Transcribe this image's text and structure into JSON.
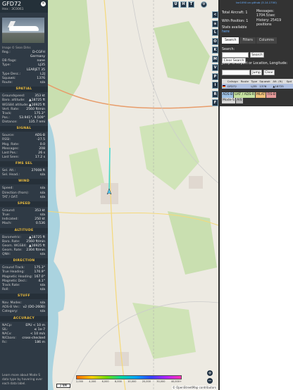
{
  "left": {
    "callsign": "GFD72",
    "hex_label": "Hex : 3C0061",
    "photo_credit": "Image © Sean Dirks",
    "info": [
      {
        "k": "Reg.:",
        "v": "D-CGFH"
      },
      {
        "k": "",
        "v": "Germany"
      },
      {
        "k": "DB flags:",
        "v": "none"
      },
      {
        "k": "Type:",
        "v": "LJ35"
      },
      {
        "k": "",
        "v": "LEARJET 35"
      },
      {
        "k": "Type Desc.:",
        "v": "L2J"
      },
      {
        "k": "Squawk:",
        "v": "1376"
      },
      {
        "k": "Route:",
        "v": "n/a"
      }
    ],
    "sections": [
      {
        "title": "SPATIAL",
        "rows": [
          {
            "k": "Groundspeed:",
            "v": "353 kt"
          },
          {
            "k": "Baro. altitude:",
            "v": "▲18725 ft"
          },
          {
            "k": "WGS84 altitude:",
            "v": "▲16925 ft"
          },
          {
            "k": "Vert. Rate:",
            "v": "2560 ft/min"
          },
          {
            "k": "Track:",
            "v": "175.3°"
          },
          {
            "k": "Pos.:",
            "v": "53.941°, 9.509°"
          },
          {
            "k": "Distance:",
            "v": "135.7 nmi"
          }
        ]
      },
      {
        "title": "SIGNAL",
        "rows": [
          {
            "k": "Source:",
            "v": "ADS-B"
          },
          {
            "k": "RSSI:",
            "v": "-27.5"
          },
          {
            "k": "Msg. Rate:",
            "v": "0.0"
          },
          {
            "k": "Messages:",
            "v": "208"
          },
          {
            "k": "Last Pos.:",
            "v": "26 s"
          },
          {
            "k": "Last Seen:",
            "v": "17.2 s"
          }
        ]
      },
      {
        "title": "FMS SEL",
        "rows": [
          {
            "k": "Sel. Alt.:",
            "v": "27008 ft"
          },
          {
            "k": "Sel. Head.:",
            "v": "n/a"
          }
        ]
      },
      {
        "title": "WIND",
        "rows": [
          {
            "k": "Speed:",
            "v": "n/a"
          },
          {
            "k": "Direction (from):",
            "v": "n/a"
          },
          {
            "k": "TAT / OAT:",
            "v": "n/a"
          }
        ]
      },
      {
        "title": "SPEED",
        "rows": [
          {
            "k": "Ground:",
            "v": "353 kt"
          },
          {
            "k": "True:",
            "v": "n/a"
          },
          {
            "k": "Indicated:",
            "v": "250 kt"
          },
          {
            "k": "Mach:",
            "v": "0.536"
          }
        ]
      },
      {
        "title": "ALTITUDE",
        "rows": [
          {
            "k": "Barometric:",
            "v": "▲18725 ft"
          },
          {
            "k": "Baro. Rate:",
            "v": "2560 ft/min"
          },
          {
            "k": "Geom. WGS84:",
            "v": "▲16925 ft"
          },
          {
            "k": "Geom. Rate:",
            "v": "2304 ft/min"
          },
          {
            "k": "QNH:",
            "v": "n/a"
          }
        ]
      },
      {
        "title": "DIRECTION",
        "rows": [
          {
            "k": "Ground Track:",
            "v": "175.3°"
          },
          {
            "k": "True Heading:",
            "v": "170.9°"
          },
          {
            "k": "Magnetic Heading:",
            "v": "167.0°"
          },
          {
            "k": "Magnetic Decl.:",
            "v": "4.1°"
          },
          {
            "k": "Track Rate:",
            "v": "n/a"
          },
          {
            "k": "Roll:",
            "v": "n/a"
          }
        ]
      },
      {
        "title": "STUFF",
        "rows": [
          {
            "k": "Nav. Modes:",
            "v": "n/a"
          },
          {
            "k": "ADS-B Ver.:",
            "v": "v2 (DO-260B)"
          },
          {
            "k": "Category:",
            "v": "n/a"
          }
        ]
      },
      {
        "title": "ACCURACY",
        "rows": [
          {
            "k": "NACp:",
            "v": "EPU < 10 m"
          },
          {
            "k": "SIL:",
            "v": "≤ 1e-7"
          },
          {
            "k": "NACv:",
            "v": "< 10 m/s"
          },
          {
            "k": "NICbaro:",
            "v": "cross-checked"
          },
          {
            "k": "Rc:",
            "v": "186 m"
          }
        ]
      }
    ],
    "learn_more": "Learn more about Mode S data type by hovering over each data label."
  },
  "map": {
    "top_buttons": [
      "U",
      "H",
      "T"
    ],
    "scale": "2 NM",
    "alt_ticks": [
      "2,000",
      "4,000",
      "6,000",
      "8,000",
      "10,000",
      "20,000",
      "30,000",
      "40,000+"
    ],
    "attribution": "© OpenStreetMap contributors"
  },
  "strip": [
    "<",
    "⊙",
    "L",
    "O",
    "K",
    "M",
    "V",
    "P",
    "I",
    "R",
    "F"
  ],
  "right": {
    "github": "tar1090 on github (3.14.1700)",
    "total_aircraft": "Total Aircraft: 1",
    "with_position": "With Position: 1",
    "stats_available": "Stats available",
    "stats_link": "here",
    "messages": "Messages: 1704.5/sec",
    "history": "History: 25419 positions",
    "tabs": [
      "Search",
      "Filters",
      "Columns"
    ],
    "search_label": "Search:",
    "search_btn": "Search",
    "clear_search": "Clear Search",
    "jump_label": "Jump to Airport or Location, Longitude:",
    "jump_btn": "Jump",
    "clear_btn": "Clear",
    "columns": [
      "Callsign",
      "Route",
      "Type",
      "Squawk",
      "Alt. (ft)",
      "Spd"
    ],
    "rows": [
      [
        "GFD72",
        "",
        "LJ35",
        "1376",
        "▲18725",
        ""
      ]
    ],
    "badges": [
      {
        "t": "ADS-B",
        "c": "#9ec2e6"
      },
      {
        "t": "UAT / ADS-R",
        "c": "#c6e2a0"
      },
      {
        "t": "MLAT",
        "c": "#f2c27a"
      },
      {
        "t": "TIS-B",
        "c": "#e59a9a"
      },
      {
        "t": "Mode-S",
        "c": "#d8d8d8"
      },
      {
        "t": "AIS",
        "c": "#bcbcbc"
      }
    ]
  }
}
